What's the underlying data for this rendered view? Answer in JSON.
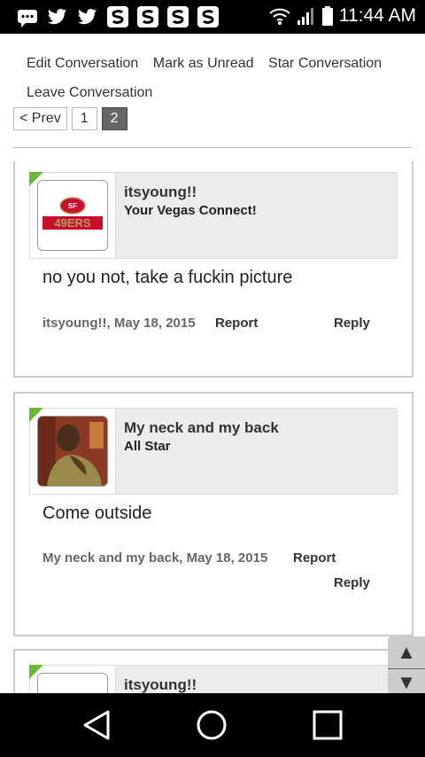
{
  "status_bar": {
    "time": "11:44 AM",
    "notification_icons": [
      "message-icon",
      "twitter-icon",
      "twitter-icon",
      "s-app-icon",
      "s-app-icon",
      "s-app-icon",
      "s-app-icon"
    ]
  },
  "menu": {
    "items": [
      "Edit Conversation",
      "Mark as Unread",
      "Star Conversation",
      "Leave Conversation"
    ]
  },
  "pagination": {
    "prev": "< Prev",
    "pages": [
      "1",
      "2"
    ],
    "current": "2"
  },
  "posts": [
    {
      "author": "itsyoung!!",
      "role": "Your Vegas Connect!",
      "avatar_text": "49ERS",
      "body": "no you not, take a fuckin picture",
      "meta": "itsyoung!!, May 18, 2015",
      "report": "Report",
      "reply": "Reply"
    },
    {
      "author": "My neck and my back",
      "role": "All Star",
      "body": "Come outside",
      "meta": "My neck and my back, May 18, 2015",
      "report": "Report",
      "reply": "Reply"
    },
    {
      "author": "itsyoung!!"
    }
  ],
  "colors": {
    "accent_corner": "#6fb836",
    "niners_red": "#c8102e",
    "niners_gold": "#b3995d"
  }
}
